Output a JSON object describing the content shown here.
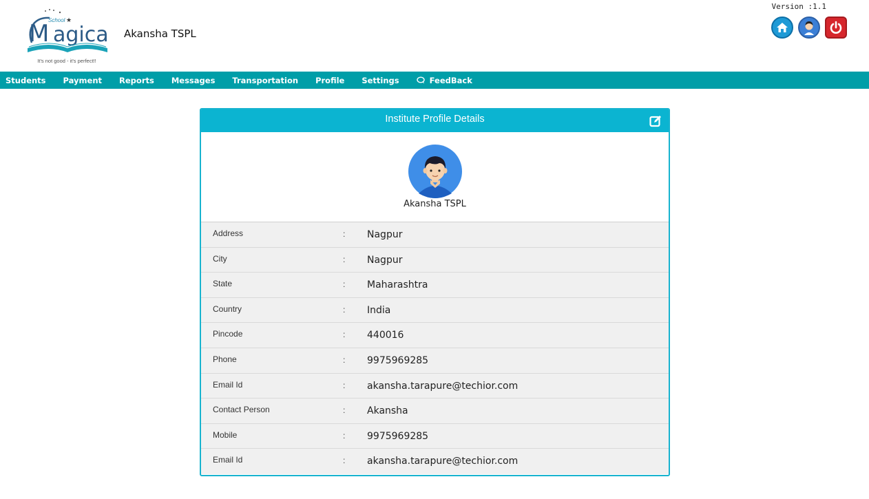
{
  "header": {
    "logo": {
      "small_text": "School",
      "brand": "Magica",
      "tagline": "It's not good - it's perfect!!"
    },
    "school_name": "Akansha TSPL",
    "version": "Version :1.1",
    "icons": [
      "home-icon",
      "user-icon",
      "power-icon"
    ]
  },
  "nav": {
    "items": [
      "Students",
      "Payment",
      "Reports",
      "Messages",
      "Transportation",
      "Profile",
      "Settings",
      "FeedBack"
    ]
  },
  "card": {
    "title": "Institute Profile Details",
    "profile_name": "Akansha TSPL",
    "colon": ":",
    "rows": [
      {
        "label": "Address",
        "value": "Nagpur"
      },
      {
        "label": "City",
        "value": "Nagpur"
      },
      {
        "label": "State",
        "value": "Maharashtra"
      },
      {
        "label": "Country",
        "value": "India"
      },
      {
        "label": "Pincode",
        "value": "440016"
      },
      {
        "label": "Phone",
        "value": "9975969285"
      },
      {
        "label": "Email Id",
        "value": "akansha.tarapure@techior.com"
      },
      {
        "label": "Contact Person",
        "value": "Akansha"
      },
      {
        "label": "Mobile",
        "value": "9975969285"
      },
      {
        "label": "Email Id",
        "value": "akansha.tarapure@techior.com"
      }
    ]
  },
  "colors": {
    "nav_bg": "#009ea8",
    "card_header": "#0bb4d1",
    "row_bg": "#f0f0f0",
    "power": "#d6262c"
  }
}
